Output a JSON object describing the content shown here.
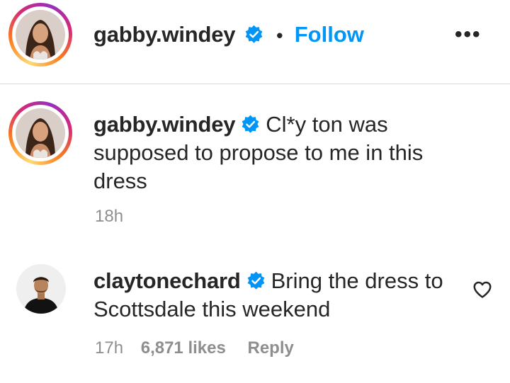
{
  "post_header": {
    "username": "gabby.windey",
    "separator": "•",
    "follow_label": "Follow",
    "more_label": "•••"
  },
  "caption": {
    "username": "gabby.windey",
    "text": "Cl*y ton was supposed to propose to me in this dress",
    "time": "18h"
  },
  "comments": [
    {
      "username": "claytonechard",
      "text": "Bring the dress to Scottsdale this weekend",
      "time": "17h",
      "likes": "6,871 likes",
      "reply_label": "Reply"
    }
  ],
  "colors": {
    "accent": "#0095f6",
    "verified": "#0095f6",
    "secondary_text": "#8e8e8e"
  }
}
